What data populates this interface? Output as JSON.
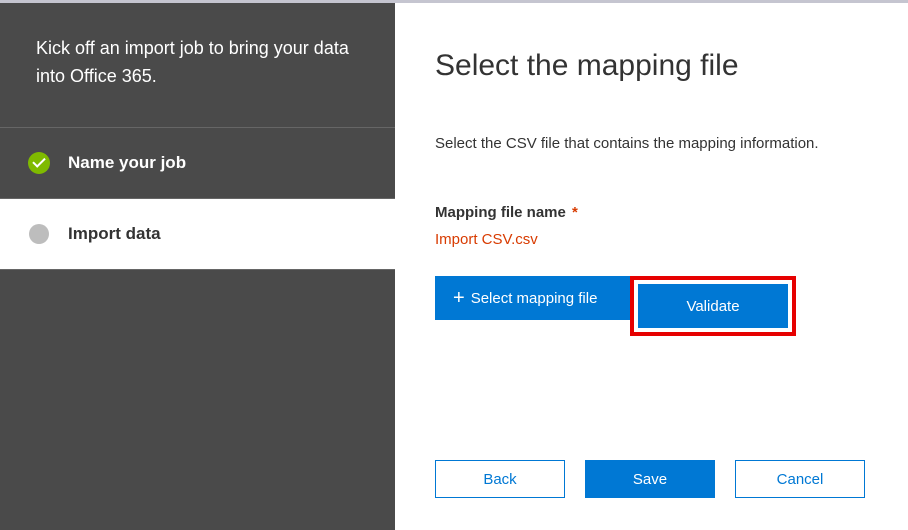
{
  "sidebar": {
    "intro": "Kick off an import job to bring your data into Office 365.",
    "steps": [
      {
        "label": "Name your job"
      },
      {
        "label": "Import data"
      }
    ]
  },
  "main": {
    "title": "Select the mapping file",
    "subtitle": "Select the CSV file that contains the mapping information.",
    "field_label": "Mapping file name",
    "required_mark": "*",
    "file_name": "Import CSV.csv",
    "select_btn": "Select mapping file",
    "validate_btn": "Validate"
  },
  "footer": {
    "back": "Back",
    "save": "Save",
    "cancel": "Cancel"
  }
}
